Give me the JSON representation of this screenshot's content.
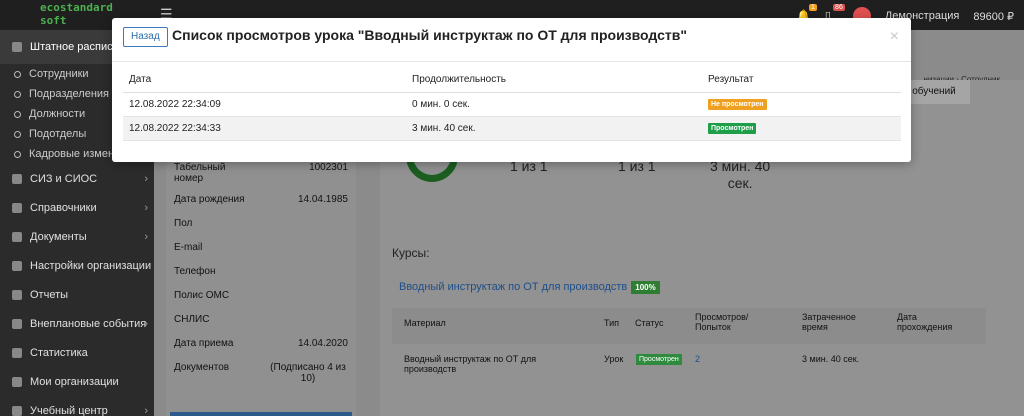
{
  "topbar": {
    "logo_line1": "ecostandard",
    "logo_line2": "soft",
    "bell_count": "1",
    "doc_count": "86",
    "user_name": "Демонстрация",
    "balance": "89600 ₽"
  },
  "sidebar": {
    "active_label": "Штатное расписание",
    "subitems": [
      "Сотрудники",
      "Подразделения",
      "Должности",
      "Подотделы",
      "Кадровые изменения"
    ],
    "items": [
      "СИЗ и СИОС",
      "Справочники",
      "Документы",
      "Настройки организации",
      "Отчеты",
      "Внеплановые события",
      "Статистика",
      "Мои организации",
      "Учебный центр"
    ]
  },
  "background": {
    "breadcrumbs": "низации › Сотрудник",
    "tab_label": "обучений",
    "stat1": "1 из 1",
    "stat2": "1 из 1",
    "stat3_line1": "3 мин. 40",
    "stat3_line2": "сек.",
    "profile_rows": [
      {
        "label": "Табельный номер",
        "value": "1002301"
      },
      {
        "label": "Дата рождения",
        "value": "14.04.1985"
      },
      {
        "label": "Пол",
        "value": ""
      },
      {
        "label": "E-mail",
        "value": ""
      },
      {
        "label": "Телефон",
        "value": ""
      },
      {
        "label": "Полис ОМС",
        "value": ""
      },
      {
        "label": "СНЛИС",
        "value": ""
      },
      {
        "label": "Дата приема",
        "value": "14.04.2020"
      },
      {
        "label": "Документов",
        "value": "(Подписано 4 из 10)"
      }
    ],
    "courses_label": "Курсы:",
    "course_link": "Вводный инструктаж по ОТ для производств",
    "course_pct": "100%",
    "materials_headers": [
      "Материал",
      "Тип",
      "Статус",
      "Просмотров/ Попыток",
      "Затраченное время",
      "Дата прохождения"
    ],
    "materials_row": {
      "material": "Вводный инструктаж по ОТ для производств",
      "type": "Урок",
      "status": "Просмотрен",
      "views": "2",
      "time": "3 мин. 40 сек.",
      "date": ""
    }
  },
  "modal": {
    "back_label": "Назад",
    "title": "Список просмотров урока \"Вводный инструктаж по ОТ для производств\"",
    "close_symbol": "×",
    "columns": [
      "Дата",
      "Продолжительность",
      "Результат"
    ],
    "rows": [
      {
        "date": "12.08.2022 22:34:09",
        "duration": "0 мин. 0 сек.",
        "result": "Не просмотрен",
        "result_color": "#f0a020"
      },
      {
        "date": "12.08.2022 22:34:33",
        "duration": "3 мин. 40 сек.",
        "result": "Просмотрен",
        "result_color": "#1e9e48"
      }
    ]
  }
}
